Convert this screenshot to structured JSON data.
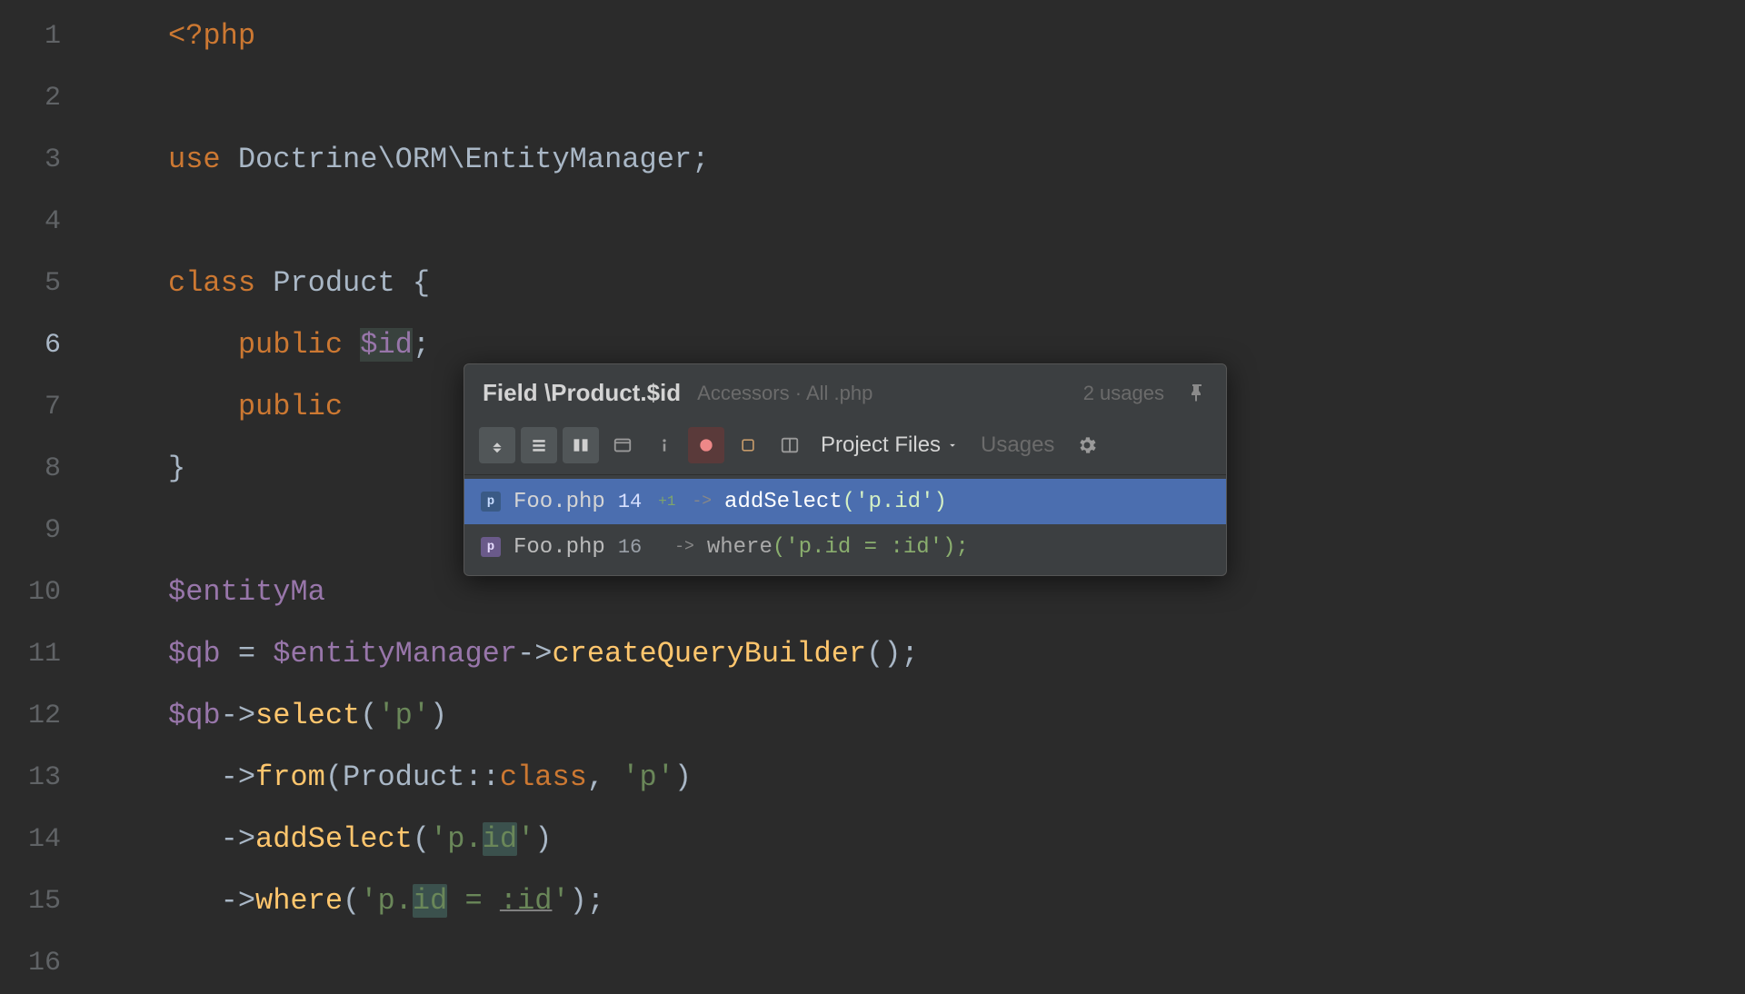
{
  "gutter": {
    "lines": [
      "1",
      "2",
      "3",
      "4",
      "5",
      "6",
      "7",
      "8",
      "9",
      "10",
      "11",
      "12",
      "13",
      "14",
      "15",
      "16"
    ],
    "active": 6
  },
  "code": {
    "l1_php": "<?php",
    "l3_use": "use",
    "l3_ns": " Doctrine\\ORM\\EntityManager;",
    "l5_class": "class",
    "l5_name": " Product {",
    "l6_pub": "    public ",
    "l6_var": "$id",
    "l6_semi": ";",
    "l7_pub": "    public ",
    "l8_close": "}",
    "l10_ent": "$entityMa",
    "l11_qb": "$qb",
    "l11_eq": " = ",
    "l11_em": "$entityManager",
    "l11_arrow": "->",
    "l11_method": "createQueryBuilder",
    "l11_call": "();",
    "l12_qb": "$qb",
    "l12_arrow": "->",
    "l12_select": "select",
    "l12_open": "(",
    "l12_str": "'p'",
    "l12_close": ")",
    "l13_arrow": "   ->",
    "l13_from": "from",
    "l13_open": "(Product::",
    "l13_classkw": "class",
    "l13_rest": ", ",
    "l13_str": "'p'",
    "l13_close": ")",
    "l14_arrow": "   ->",
    "l14_add": "addSelect",
    "l14_open": "(",
    "l14_str_a": "'p.",
    "l14_str_id": "id",
    "l14_str_b": "'",
    "l14_close": ")",
    "l15_arrow": "   ->",
    "l15_where": "where",
    "l15_open": "(",
    "l15_str_a": "'p.",
    "l15_str_id": "id",
    "l15_str_b": " = ",
    "l15_str_c": ":id",
    "l15_str_d": "'",
    "l15_close": ");"
  },
  "popup": {
    "title": "Field \\Product.$id",
    "subtitle": "Accessors · All .php",
    "count": "2 usages",
    "scope_label": "Project Files",
    "usages_label": "Usages",
    "results": [
      {
        "file": "Foo.php",
        "line": "14",
        "badge": "+1",
        "arrow": "->",
        "snippet_method": "addSelect",
        "snippet_arg": "('p.id')"
      },
      {
        "file": "Foo.php",
        "line": "16",
        "badge": "",
        "arrow": "->",
        "snippet_method": "where",
        "snippet_arg": "('p.id = :id');"
      }
    ]
  }
}
